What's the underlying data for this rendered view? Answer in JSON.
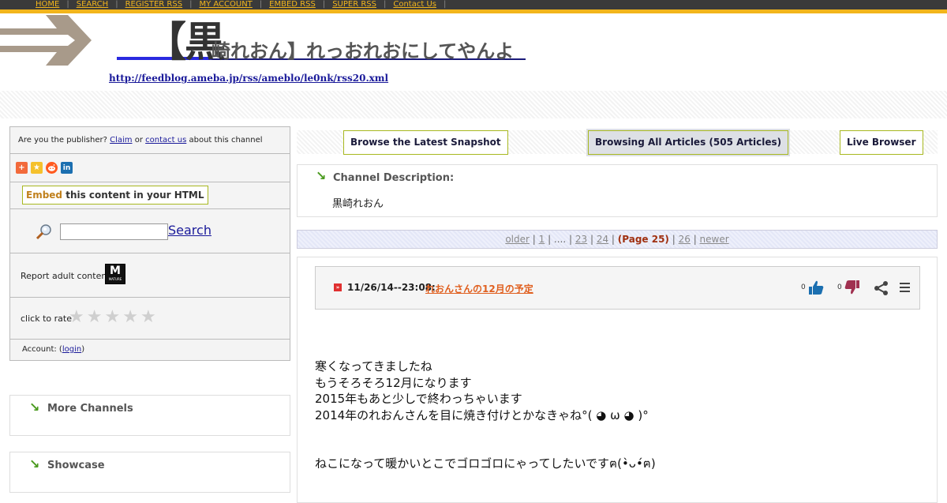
{
  "nav": {
    "items": [
      "HOME",
      "SEARCH",
      "REGISTER RSS",
      "MY ACCOUNT",
      "EMBED RSS",
      "SUPER RSS",
      "Contact Us"
    ]
  },
  "header": {
    "title_big": "【黒",
    "title_rest": "崎れおん】れっおれおにしてやんよ",
    "feed_url": "http://feedblog.ameba.jp/rss/ameblo/le0nk/rss20.xml",
    "arrow_color": "#a89a8a"
  },
  "sidebar": {
    "publisher": {
      "prefix": "Are you the publisher?",
      "claim": "Claim",
      "or": "or",
      "contact": "contact us",
      "suffix": "about this channel"
    },
    "social": [
      "plus-icon",
      "star-icon",
      "reddit-icon",
      "linkedin-icon"
    ],
    "embed": {
      "highlight": "Embed",
      "rest": "this content in your HTML"
    },
    "search": {
      "placeholder": "",
      "button": "Search"
    },
    "adult": {
      "label": "Report adult content:",
      "badge": "M",
      "badge_sub": "MATURE"
    },
    "rate": {
      "label": "click to rate",
      "stars": 5,
      "rating": 0
    },
    "account": {
      "prefix": "Account: (",
      "login": "login",
      "suffix": ")"
    }
  },
  "side_boxes": {
    "more_channels": "More Channels",
    "showcase": "Showcase"
  },
  "tabs": {
    "latest": "Browse the Latest Snapshot",
    "all": "Browsing All Articles (505 Articles)",
    "live": "Live Browser"
  },
  "channel": {
    "heading": "Channel Description:",
    "description": "黒崎れおん"
  },
  "pager": {
    "older": "older",
    "p1": "1",
    "dots": "....",
    "p23": "23",
    "p24": "24",
    "current": "(Page 25)",
    "p26": "26",
    "newer": "newer"
  },
  "article": {
    "date": "11/26/14--23:08:",
    "title": "れおんさんの12月の予定",
    "likes": "0",
    "dislikes": "0",
    "body": [
      "寒くなってきましたね",
      "もうそろそろ12月になります",
      "2015年もあと少しで終わっちゃいます",
      "2014年のれおんさんを目に焼き付けとかなきゃね°( ◕ ω ◕ )°",
      "",
      "ねこになって暖かいとこでゴロゴロにゃってしたいですฅ(•̀ᴗ•́ฅ)"
    ],
    "colors": {
      "title": "#e06020",
      "like": "#1b6fb0",
      "dislike": "#a03050"
    }
  }
}
